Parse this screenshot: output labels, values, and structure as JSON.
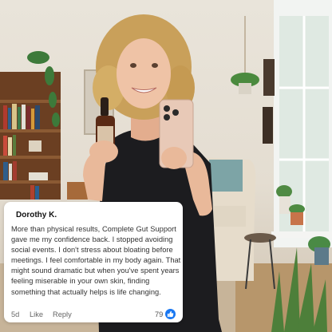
{
  "comment": {
    "author": "Dorothy K.",
    "text": "More than physical results, Complete Gut Support gave me my confidence back. I stopped avoiding social events. I don't stress about bloating before meetings. I feel comfortable in my body again. That might sound dramatic but when you've spent years feeling miserable in your own skin, finding something that actually helps is life changing.",
    "time": "5d",
    "like_label": "Like",
    "reply_label": "Reply",
    "reaction_count": "79"
  },
  "colors": {
    "like_blue": "#1877f2",
    "dress": "#1c1c1f",
    "hair": "#c9a05a",
    "wall": "#e9e4da"
  },
  "icons": {
    "reaction": "thumbs-up-icon"
  }
}
